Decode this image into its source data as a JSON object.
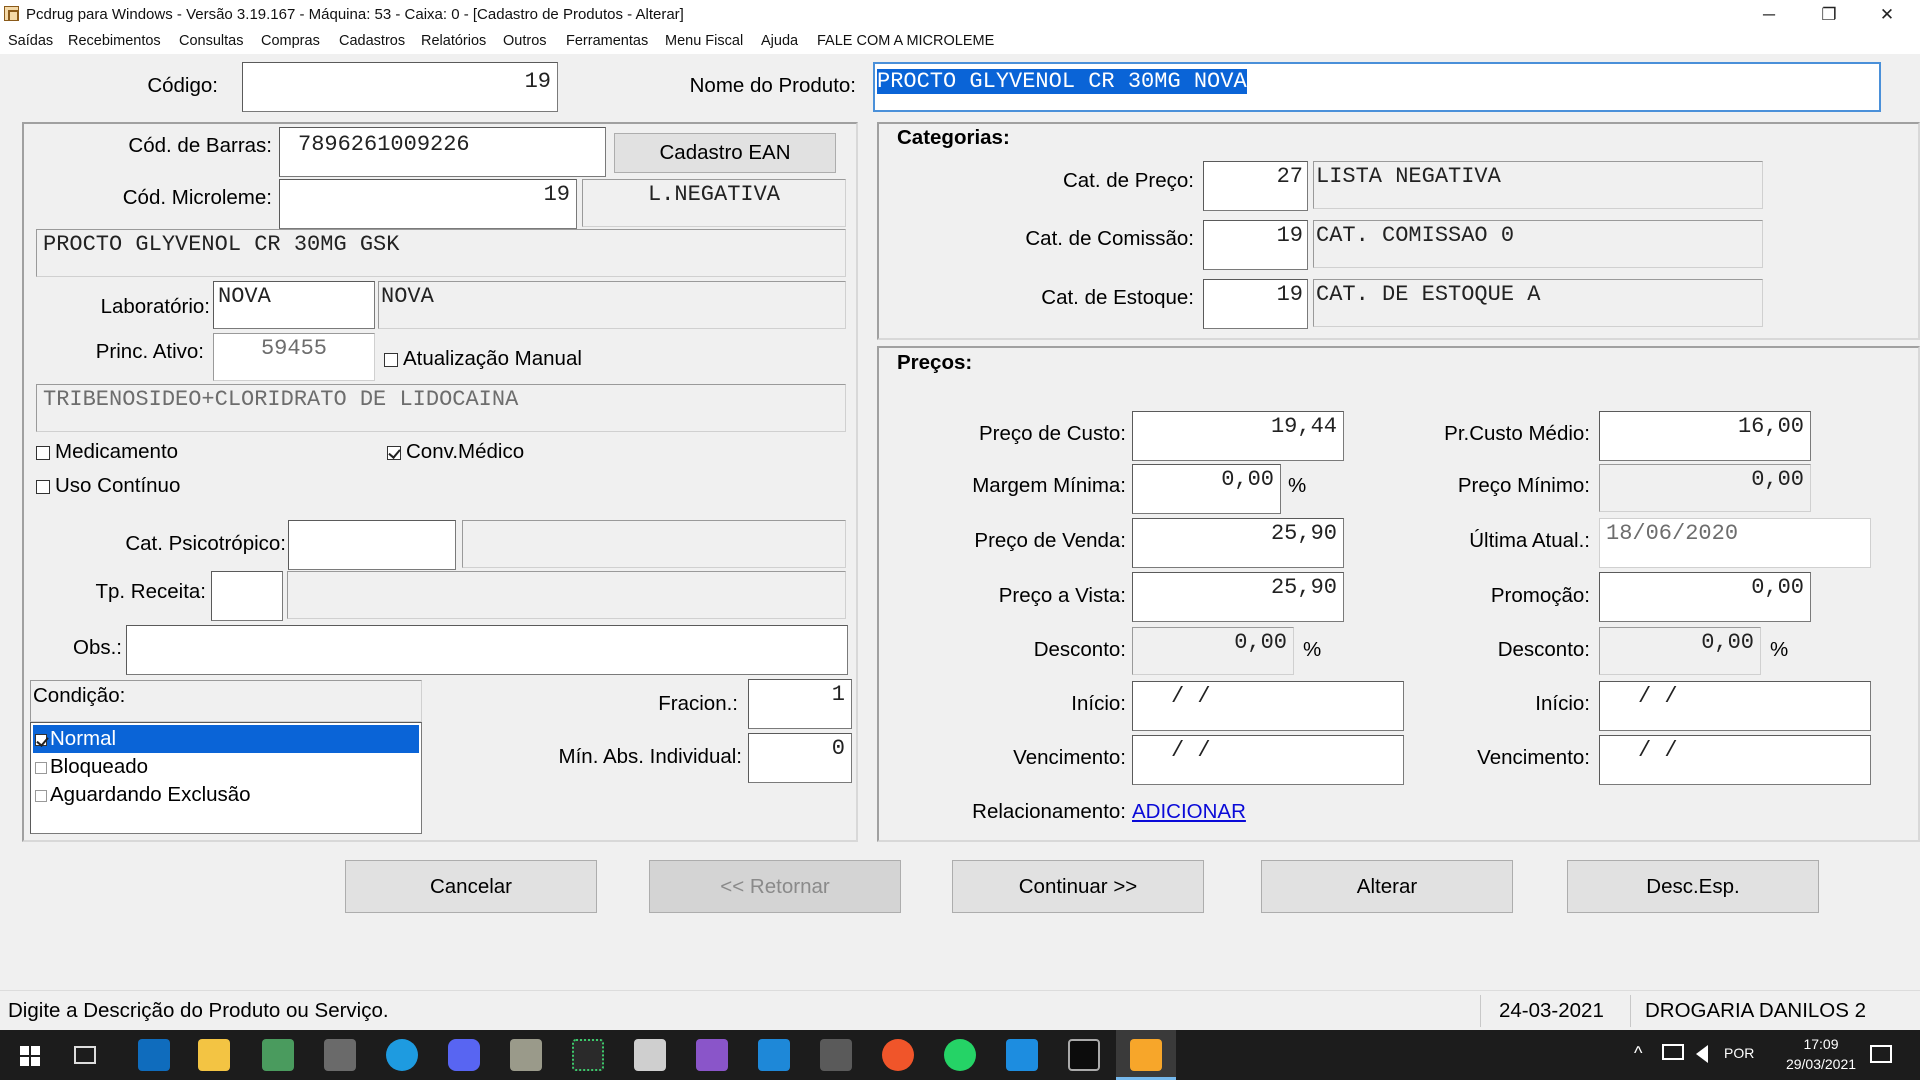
{
  "window": {
    "title": "Pcdrug para Windows - Versão 3.19.167 - Máquina: 53 - Caixa: 0 - [Cadastro de Produtos - Alterar]",
    "min": "─",
    "max": "❐",
    "close": "✕"
  },
  "menu": [
    "Saídas",
    "Recebimentos",
    "Consultas",
    "Compras",
    "Cadastros",
    "Relatórios",
    "Outros",
    "Ferramentas",
    "Menu Fiscal",
    "Ajuda",
    "FALE COM A MICROLEME"
  ],
  "header": {
    "codigo_label": "Código:",
    "codigo": "19",
    "nome_label": "Nome do Produto:",
    "nome": "PROCTO GLYVENOL CR 30MG NOVA"
  },
  "left": {
    "barras_label": "Cód. de Barras:",
    "barras": "7896261009226",
    "cadastro_ean": "Cadastro EAN",
    "microleme_label": "Cód. Microleme:",
    "microleme": "19",
    "microleme_desc": "L.NEGATIVA",
    "descricao": "PROCTO GLYVENOL CR 30MG GSK",
    "laboratorio_label": "Laboratório:",
    "laboratorio_cod": "NOVA",
    "laboratorio_nome": "NOVA",
    "principio_label": "Princ. Ativo:",
    "principio_cod": "59455",
    "atualizacao_manual": "Atualização Manual",
    "principio_desc": "TRIBENOSIDEO+CLORIDRATO DE LIDOCAINA",
    "medicamento": "Medicamento",
    "conv_medico": "Conv.Médico",
    "uso_continuo": "Uso Contínuo",
    "psicotropico_label": "Cat. Psicotrópico:",
    "receita_label": "Tp. Receita:",
    "obs_label": "Obs.:",
    "condicao_label": "Condição:",
    "condicoes": [
      "Normal",
      "Bloqueado",
      "Aguardando Exclusão"
    ],
    "fracion_label": "Fracion.:",
    "fracion": "1",
    "min_abs_label": "Mín. Abs. Individual:",
    "min_abs": "0"
  },
  "categorias": {
    "title": "Categorias:",
    "preco_label": "Cat. de Preço:",
    "preco_cod": "27",
    "preco_nome": "LISTA NEGATIVA",
    "comissao_label": "Cat. de Comissão:",
    "comissao_cod": "19",
    "comissao_nome": "CAT. COMISSAO 0",
    "estoque_label": "Cat. de Estoque:",
    "estoque_cod": "19",
    "estoque_nome": "CAT. DE ESTOQUE A"
  },
  "precos": {
    "title": "Preços:",
    "custo_label": "Preço de Custo:",
    "custo": "19,44",
    "custo_medio_label": "Pr.Custo Médio:",
    "custo_medio": "16,00",
    "margem_label": "Margem Mínima:",
    "margem": "0,00",
    "pct": "%",
    "preco_min_label": "Preço Mínimo:",
    "preco_min": "0,00",
    "venda_label": "Preço de Venda:",
    "venda": "25,90",
    "ultima_label": "Última Atual.:",
    "ultima": "18/06/2020",
    "vista_label": "Preço a Vista:",
    "vista": "25,90",
    "promocao_label": "Promoção:",
    "promocao": "0,00",
    "desconto_label": "Desconto:",
    "desconto": "0,00",
    "desconto2": "0,00",
    "inicio_label": "Início:",
    "data_vazia": "/   /",
    "vencimento_label": "Vencimento:",
    "relacionamento_label": "Relacionamento:",
    "adicionar": "ADICIONAR"
  },
  "buttons": {
    "cancelar": "Cancelar",
    "retornar": "<< Retornar",
    "continuar": "Continuar >>",
    "alterar": "Alterar",
    "desc_esp": "Desc.Esp."
  },
  "status": {
    "hint": "Digite a Descrição do Produto ou Serviço.",
    "date": "24-03-2021",
    "store": "DROGARIA DANILOS 2"
  },
  "taskbar": {
    "lang": "POR",
    "time": "17:09",
    "date": "29/03/2021",
    "tray": "^"
  }
}
